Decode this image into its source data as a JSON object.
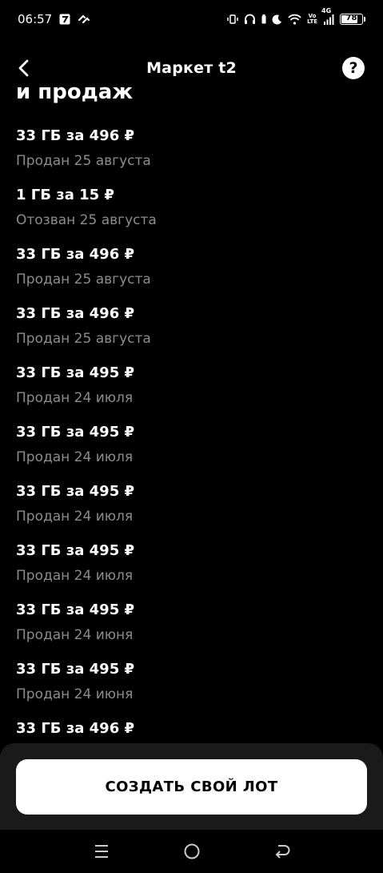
{
  "status_bar": {
    "time": "06:57",
    "volte_top": "Vo",
    "volte_bottom": "LTE",
    "network": "4G",
    "battery": "78",
    "battery_level": 0.78
  },
  "header": {
    "title": "Маркет t2"
  },
  "section_title": "и продаж",
  "lots": [
    {
      "title": "33 ГБ за 496 ₽",
      "status": "Продан 25 августа"
    },
    {
      "title": "1 ГБ за 15 ₽",
      "status": "Отозван 25 августа"
    },
    {
      "title": "33 ГБ за 496 ₽",
      "status": "Продан 25 августа"
    },
    {
      "title": "33 ГБ за 496 ₽",
      "status": "Продан 25 августа"
    },
    {
      "title": "33 ГБ за 495 ₽",
      "status": "Продан 24 июля"
    },
    {
      "title": "33 ГБ за 495 ₽",
      "status": "Продан 24 июля"
    },
    {
      "title": "33 ГБ за 495 ₽",
      "status": "Продан 24 июля"
    },
    {
      "title": "33 ГБ за 495 ₽",
      "status": "Продан 24 июля"
    },
    {
      "title": "33 ГБ за 495 ₽",
      "status": "Продан 24 июня"
    },
    {
      "title": "33 ГБ за 495 ₽",
      "status": "Продан 24 июня"
    },
    {
      "title": "33 ГБ за 496 ₽",
      "status": ""
    }
  ],
  "create_button": "СОЗДАТЬ СВОЙ ЛОТ",
  "icons": {
    "back": "back-arrow-icon",
    "help": "question-icon"
  },
  "colors": {
    "background": "#000000",
    "secondary_text": "#8c8c8c",
    "button_bg": "#ffffff",
    "panel_bg": "#1a1a1a"
  }
}
